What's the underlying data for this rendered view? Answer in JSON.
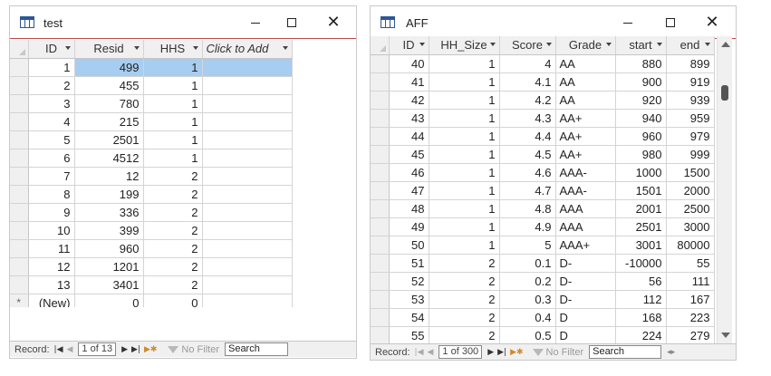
{
  "test": {
    "title": "test",
    "columns": [
      "ID",
      "Resid",
      "HHS",
      "Click to Add"
    ],
    "rows": [
      [
        "1",
        "499",
        "1"
      ],
      [
        "2",
        "455",
        "1"
      ],
      [
        "3",
        "780",
        "1"
      ],
      [
        "4",
        "215",
        "1"
      ],
      [
        "5",
        "2501",
        "1"
      ],
      [
        "6",
        "4512",
        "1"
      ],
      [
        "7",
        "12",
        "2"
      ],
      [
        "8",
        "199",
        "2"
      ],
      [
        "9",
        "336",
        "2"
      ],
      [
        "10",
        "399",
        "2"
      ],
      [
        "11",
        "960",
        "2"
      ],
      [
        "12",
        "1201",
        "2"
      ],
      [
        "13",
        "3401",
        "2"
      ]
    ],
    "new_row": {
      "marker": "*",
      "id": "(New)",
      "resid": "0",
      "hhs": "0"
    },
    "nav": {
      "label": "Record:",
      "position": "1 of 13",
      "filter": "No Filter",
      "search": "Search"
    }
  },
  "aff": {
    "title": "AFF",
    "columns": [
      "ID",
      "HH_Size",
      "Score",
      "Grade",
      "start",
      "end"
    ],
    "rows": [
      [
        "40",
        "1",
        "4",
        "AA",
        "880",
        "899"
      ],
      [
        "41",
        "1",
        "4.1",
        "AA",
        "900",
        "919"
      ],
      [
        "42",
        "1",
        "4.2",
        "AA",
        "920",
        "939"
      ],
      [
        "43",
        "1",
        "4.3",
        "AA+",
        "940",
        "959"
      ],
      [
        "44",
        "1",
        "4.4",
        "AA+",
        "960",
        "979"
      ],
      [
        "45",
        "1",
        "4.5",
        "AA+",
        "980",
        "999"
      ],
      [
        "46",
        "1",
        "4.6",
        "AAA-",
        "1000",
        "1500"
      ],
      [
        "47",
        "1",
        "4.7",
        "AAA-",
        "1501",
        "2000"
      ],
      [
        "48",
        "1",
        "4.8",
        "AAA",
        "2001",
        "2500"
      ],
      [
        "49",
        "1",
        "4.9",
        "AAA",
        "2501",
        "3000"
      ],
      [
        "50",
        "1",
        "5",
        "AAA+",
        "3001",
        "80000"
      ],
      [
        "51",
        "2",
        "0.1",
        "D-",
        "-10000",
        "55"
      ],
      [
        "52",
        "2",
        "0.2",
        "D-",
        "56",
        "111"
      ],
      [
        "53",
        "2",
        "0.3",
        "D-",
        "112",
        "167"
      ],
      [
        "54",
        "2",
        "0.4",
        "D",
        "168",
        "223"
      ],
      [
        "55",
        "2",
        "0.5",
        "D",
        "224",
        "279"
      ]
    ],
    "nav": {
      "label": "Record:",
      "position": "1 of 300",
      "filter": "No Filter",
      "search": "Search"
    }
  },
  "colors": {
    "selection": "#a7cdf0",
    "accent_border": "#b94a4a",
    "header_bg": "#f0f0f0"
  }
}
